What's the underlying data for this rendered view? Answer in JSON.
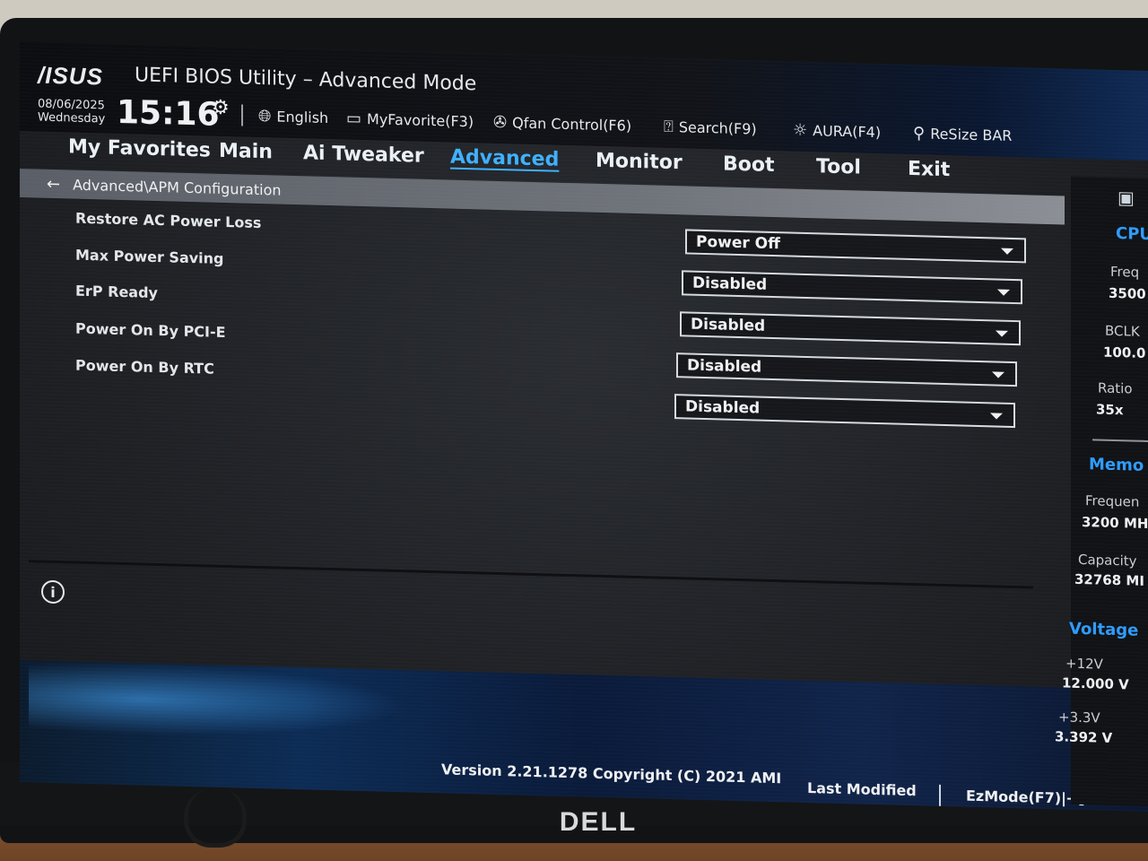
{
  "header": {
    "brand": "/ISUS",
    "title": "UEFI BIOS Utility – Advanced Mode",
    "date": "08/06/2025",
    "weekday": "Wednesday",
    "time": "15:16",
    "toolbar": {
      "language": "English",
      "my_favorite": "MyFavorite(F3)",
      "qfan": "Qfan Control(F6)",
      "search": "Search(F9)",
      "aura": "AURA(F4)",
      "resize_bar": "ReSize BAR"
    }
  },
  "tabs": [
    {
      "label": "My Favorites"
    },
    {
      "label": "Main"
    },
    {
      "label": "Ai Tweaker"
    },
    {
      "label": "Advanced",
      "active": true
    },
    {
      "label": "Monitor"
    },
    {
      "label": "Boot"
    },
    {
      "label": "Tool"
    },
    {
      "label": "Exit"
    }
  ],
  "breadcrumb": "Advanced\\APM Configuration",
  "settings": [
    {
      "label": "Restore AC Power Loss",
      "value": "Power Off"
    },
    {
      "label": "Max Power Saving",
      "value": "Disabled"
    },
    {
      "label": "ErP Ready",
      "value": "Disabled"
    },
    {
      "label": "Power On By PCI-E",
      "value": "Disabled"
    },
    {
      "label": "Power On By RTC",
      "value": "Disabled"
    }
  ],
  "hardware_monitor": {
    "cpu": {
      "title": "CPU",
      "freq_label": "Freq",
      "freq_value": "3500",
      "bclk_label": "BCLK",
      "bclk_value": "100.0",
      "ratio_label": "Ratio",
      "ratio_value": "35x"
    },
    "memory": {
      "title": "Memo",
      "freq_label": "Frequen",
      "freq_value": "3200 MH",
      "cap_label": "Capacity",
      "cap_value": "32768 MI"
    },
    "voltage": {
      "title": "Voltage",
      "v12_label": "+12V",
      "v12_value": "12.000 V",
      "v33_label": "+3.3V",
      "v33_value": "3.392 V"
    }
  },
  "footer": {
    "version": "Version 2.21.1278 Copyright (C) 2021 AMI",
    "last_modified": "Last Modified",
    "ezmode": "EzMode(F7)|→]"
  },
  "monitor_brand": "DELL",
  "colors": {
    "accent": "#3fb0ff",
    "section": "#2e9cff",
    "background": "#1e2024"
  }
}
